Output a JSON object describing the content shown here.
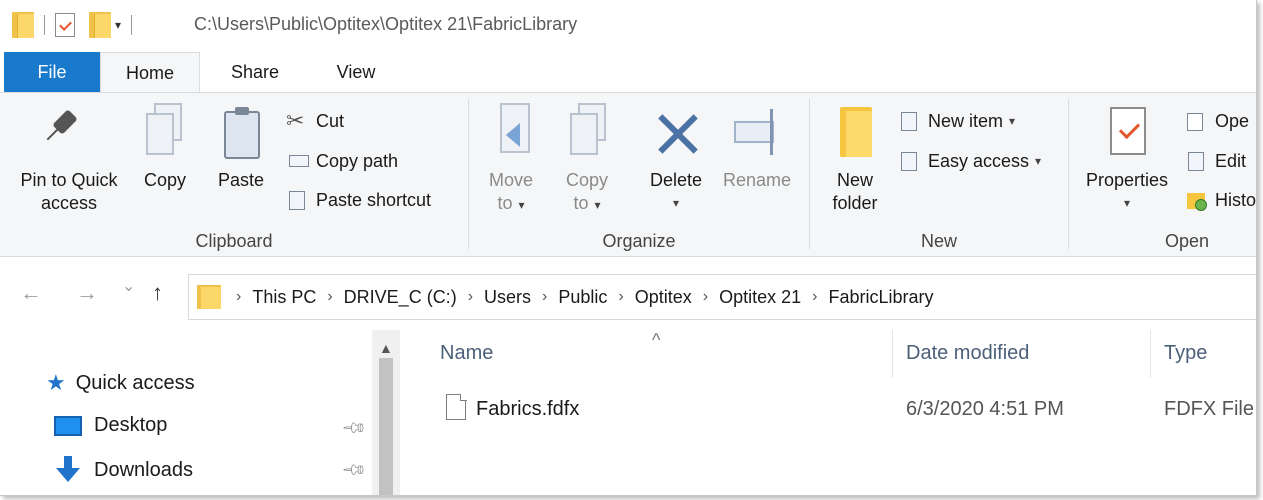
{
  "titlebar": {
    "path": "C:\\Users\\Public\\Optitex\\Optitex 21\\FabricLibrary",
    "qat_dropdown": "▾"
  },
  "ribbon_tabs": [
    "File",
    "Home",
    "Share",
    "View"
  ],
  "ribbon": {
    "clipboard": {
      "label": "Clipboard",
      "pin_line1": "Pin to Quick",
      "pin_line2": "access",
      "copy": "Copy",
      "paste": "Paste",
      "cut": "Cut",
      "copy_path": "Copy path",
      "paste_shortcut": "Paste shortcut"
    },
    "organize": {
      "label": "Organize",
      "move_line1": "Move",
      "move_line2": "to",
      "copy_line1": "Copy",
      "copy_line2": "to",
      "delete": "Delete",
      "rename": "Rename"
    },
    "new": {
      "label": "New",
      "folder_line1": "New",
      "folder_line2": "folder",
      "new_item": "New item",
      "easy_access": "Easy access"
    },
    "open": {
      "label": "Open",
      "properties": "Properties",
      "open": "Ope",
      "edit": "Edit",
      "history": "Histo"
    }
  },
  "address": {
    "back": "←",
    "forward": "→",
    "recent": "⌄",
    "up": "↑",
    "crumbs": [
      "This PC",
      "DRIVE_C (C:)",
      "Users",
      "Public",
      "Optitex",
      "Optitex 21",
      "FabricLibrary"
    ],
    "separator": "›"
  },
  "nav_pane": {
    "items": [
      {
        "label": "Quick access",
        "icon": "star-icon"
      },
      {
        "label": "Desktop",
        "icon": "desktop-icon"
      },
      {
        "label": "Downloads",
        "icon": "downloads-icon"
      }
    ]
  },
  "file_list": {
    "columns": [
      "Name",
      "Date modified",
      "Type"
    ],
    "rows": [
      {
        "name": "Fabrics.fdfx",
        "date": "6/3/2020 4:51 PM",
        "type": "FDFX File"
      }
    ]
  },
  "colors": {
    "file_tab": "#1979ca",
    "ribbon_bg": "#f5f6f7",
    "folder_yellow": "#fcd86a"
  }
}
